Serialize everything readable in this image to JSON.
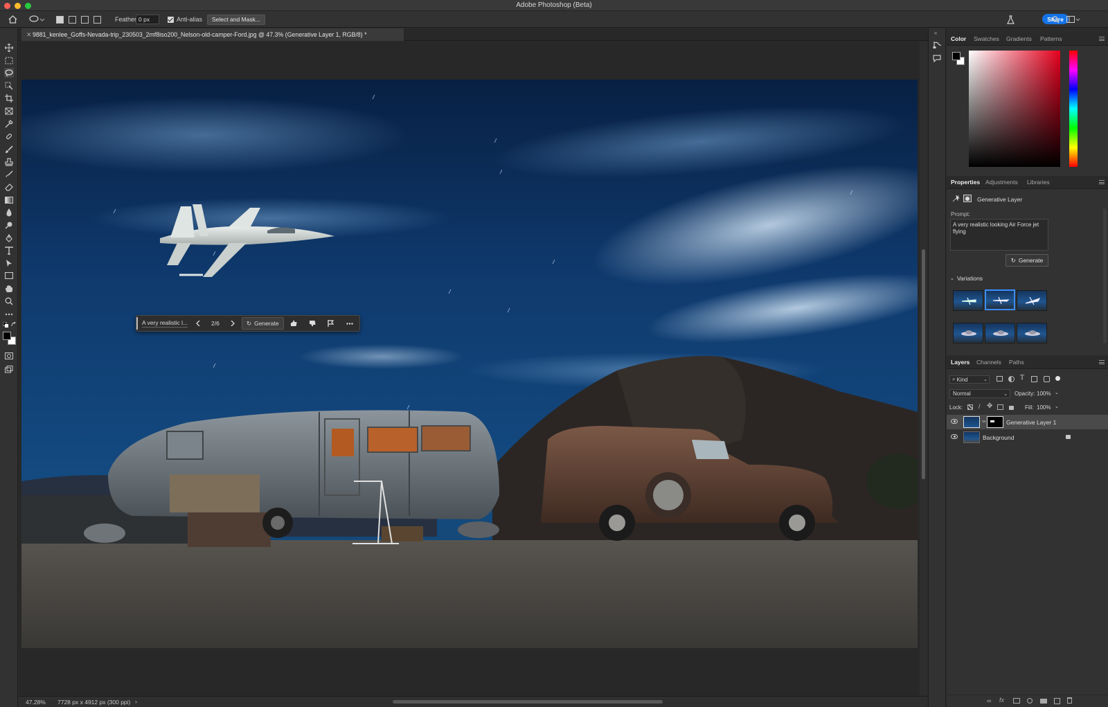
{
  "app": {
    "title": "Adobe Photoshop (Beta)"
  },
  "options_bar": {
    "feather_label": "Feather:",
    "feather_value": "0 px",
    "antialias_label": "Anti-alias",
    "antialias_checked": true,
    "select_and_mask": "Select and Mask...",
    "share": "Share"
  },
  "document": {
    "tab_title": "9881_kenlee_Goffs-Nevada-trip_230503_2mf8iso200_Nelson-old-camper-Ford.jpg @ 47.3% (Generative Layer 1, RGB/8) *"
  },
  "contextual_bar": {
    "prompt_preview": "A very realistic l...",
    "page": "2/6",
    "generate": "Generate"
  },
  "status": {
    "zoom": "47.28%",
    "doc_size": "7728 px x 4912 px (300 ppi)"
  },
  "color_panel": {
    "tabs": [
      "Color",
      "Swatches",
      "Gradients",
      "Patterns"
    ],
    "foreground": "#000000",
    "background": "#ffffff"
  },
  "properties_panel": {
    "tabs": [
      "Properties",
      "Adjustments",
      "Libraries"
    ],
    "layer_type": "Generative Layer",
    "prompt_label": "Prompt:",
    "prompt_text": "A very realistic looking Air Force jet flying",
    "generate": "Generate",
    "variations_label": "Variations",
    "selected_variation": 2
  },
  "layers_panel": {
    "tabs": [
      "Layers",
      "Channels",
      "Paths"
    ],
    "kind": "Kind",
    "blend_mode": "Normal",
    "opacity_label": "Opacity:",
    "opacity": "100%",
    "lock_label": "Lock:",
    "fill_label": "Fill:",
    "fill": "100%",
    "layers": [
      {
        "name": "Generative Layer 1",
        "selected": true
      },
      {
        "name": "Background",
        "locked": true
      }
    ]
  },
  "colors": {
    "accent": "#1473e6",
    "selection": "#3a8eff"
  }
}
